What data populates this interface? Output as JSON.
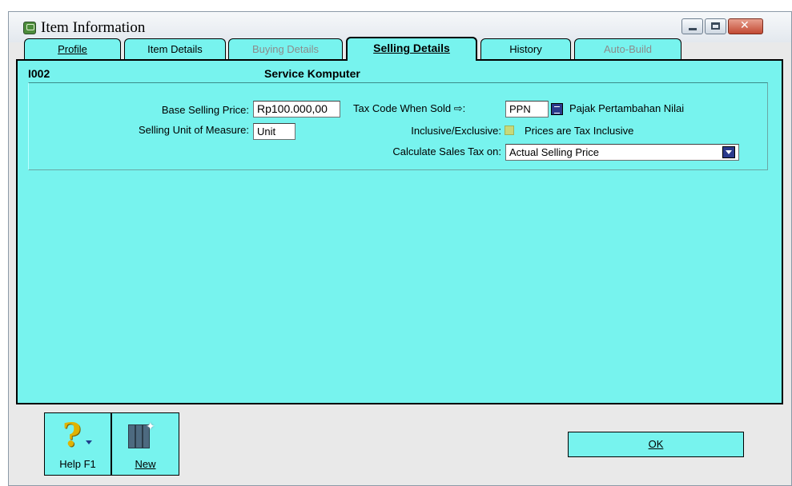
{
  "window": {
    "title": "Item Information"
  },
  "tabs": [
    {
      "label": "Profile",
      "state": "enabled"
    },
    {
      "label": "Item Details",
      "state": "enabled"
    },
    {
      "label": "Buying Details",
      "state": "disabled"
    },
    {
      "label": "Selling Details",
      "state": "active"
    },
    {
      "label": "History",
      "state": "enabled"
    },
    {
      "label": "Auto-Build",
      "state": "disabled"
    }
  ],
  "item": {
    "code": "I002",
    "name": "Service Komputer"
  },
  "form": {
    "base_selling_price_label": "Base Selling Price:",
    "base_selling_price_value": "Rp100.000,00",
    "unit_label": "Selling Unit of Measure:",
    "unit_value": "Unit",
    "tax_code_label": "Tax Code When Sold ⇨:",
    "tax_code_value": "PPN",
    "tax_code_desc": "Pajak Pertambahan Nilai",
    "inclusive_label": "Inclusive/Exclusive:",
    "inclusive_text": "Prices are Tax Inclusive",
    "inclusive_checked": false,
    "calc_label": "Calculate Sales Tax on:",
    "calc_value": "Actual Selling Price"
  },
  "toolbar": {
    "help_label": "Help F1",
    "new_label": "New",
    "ok_label": "OK"
  },
  "icons": {
    "app": "item-window-icon",
    "help": "question-mark-icon",
    "new": "new-books-icon",
    "tax_lookup": "list-lookup-icon",
    "dropdown": "chevron-down-icon"
  },
  "colors": {
    "panel": "#77f3ee",
    "window_bg": "#e9e9e9",
    "close_button": "#c24a33"
  }
}
